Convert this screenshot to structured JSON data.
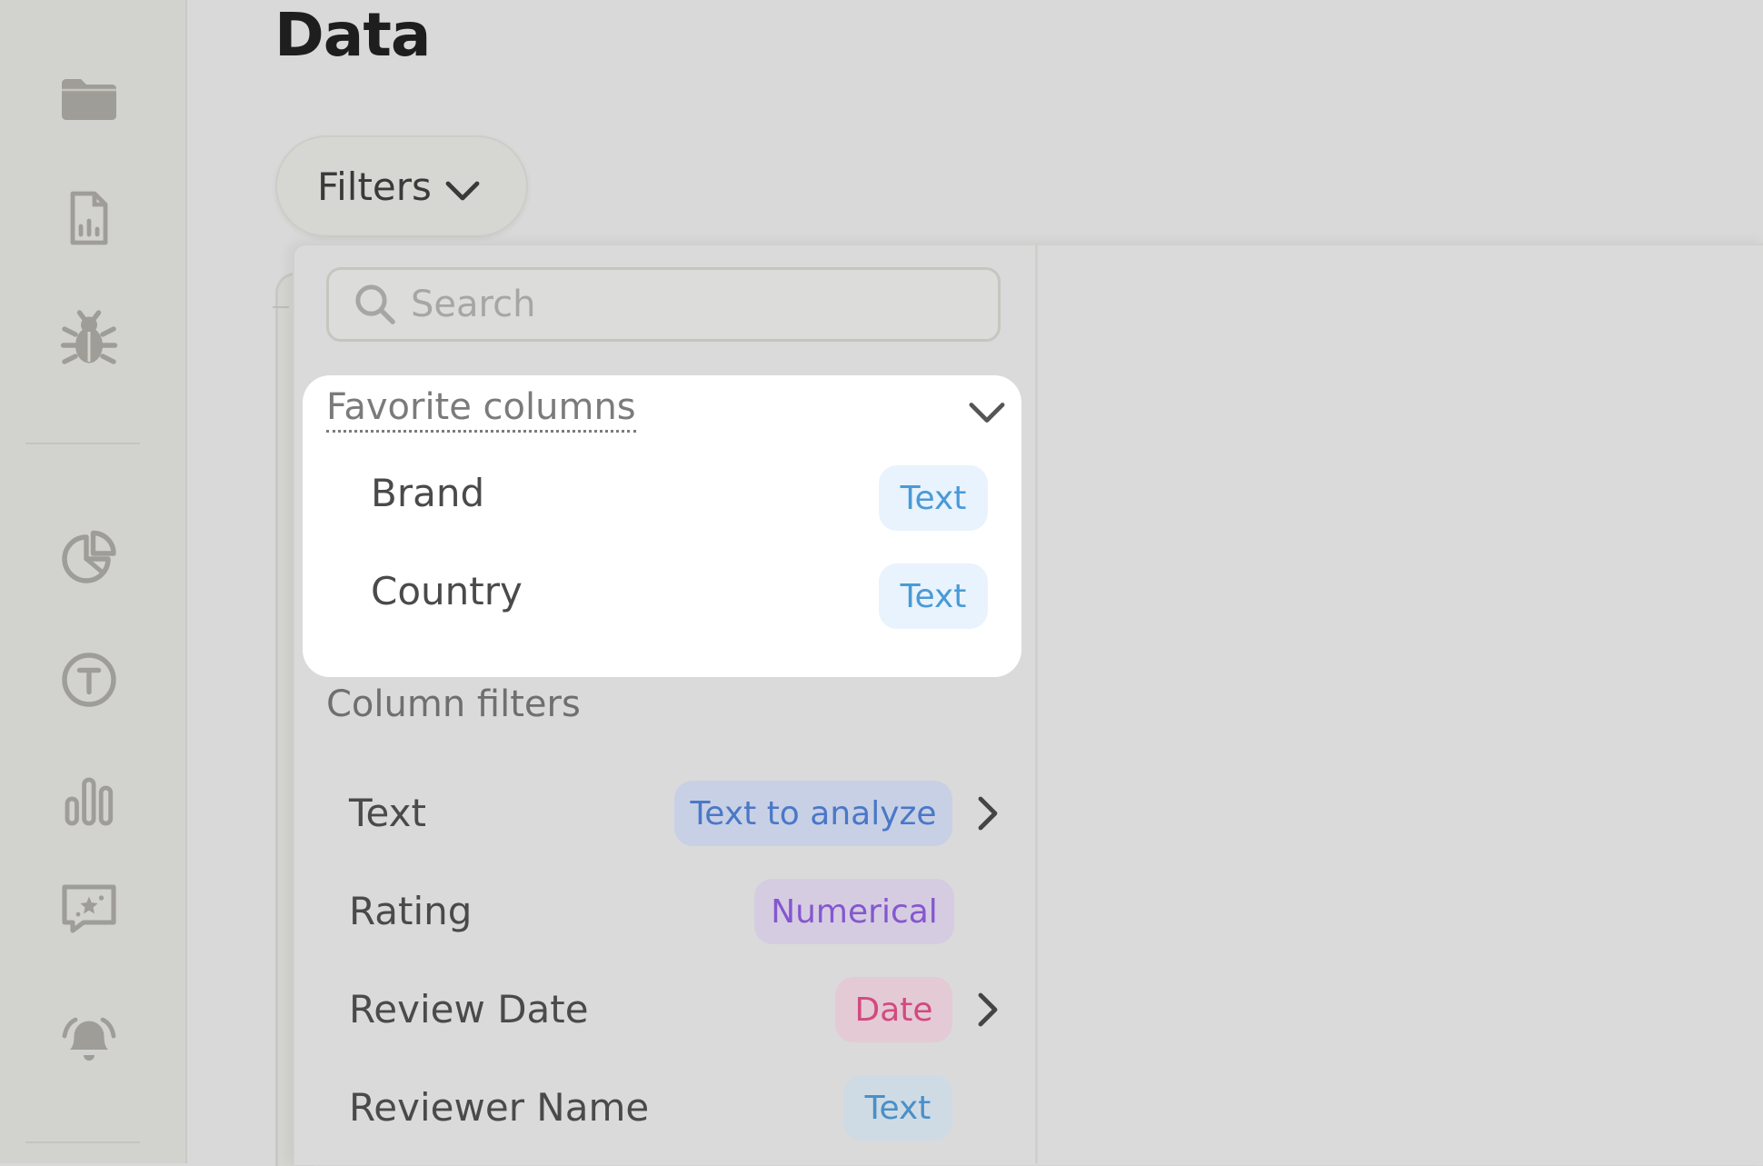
{
  "sidebar": {
    "icons": [
      "folder-icon",
      "report-icon",
      "bug-icon",
      "pie-chart-icon",
      "text-circle-icon",
      "bar-chart-icon",
      "ai-chat-icon",
      "bell-icon"
    ]
  },
  "header": {
    "title": "Data"
  },
  "filters": {
    "label": "Filters"
  },
  "search": {
    "placeholder": "Search"
  },
  "favorites": {
    "title": "Favorite columns",
    "items": [
      {
        "label": "Brand",
        "type": "Text"
      },
      {
        "label": "Country",
        "type": "Text"
      }
    ]
  },
  "column_filters": {
    "title": "Column filters",
    "items": [
      {
        "label": "Text",
        "type": "Text to analyze",
        "has_submenu": true
      },
      {
        "label": "Rating",
        "type": "Numerical",
        "has_submenu": false
      },
      {
        "label": "Review Date",
        "type": "Date",
        "has_submenu": true
      },
      {
        "label": "Reviewer Name",
        "type": "Text",
        "has_submenu": false
      }
    ]
  },
  "colors": {
    "text_badge": "#4a9ad6",
    "analyze_badge": "#4a78c8",
    "numerical_badge": "#8557cf",
    "date_badge": "#d14a80"
  }
}
